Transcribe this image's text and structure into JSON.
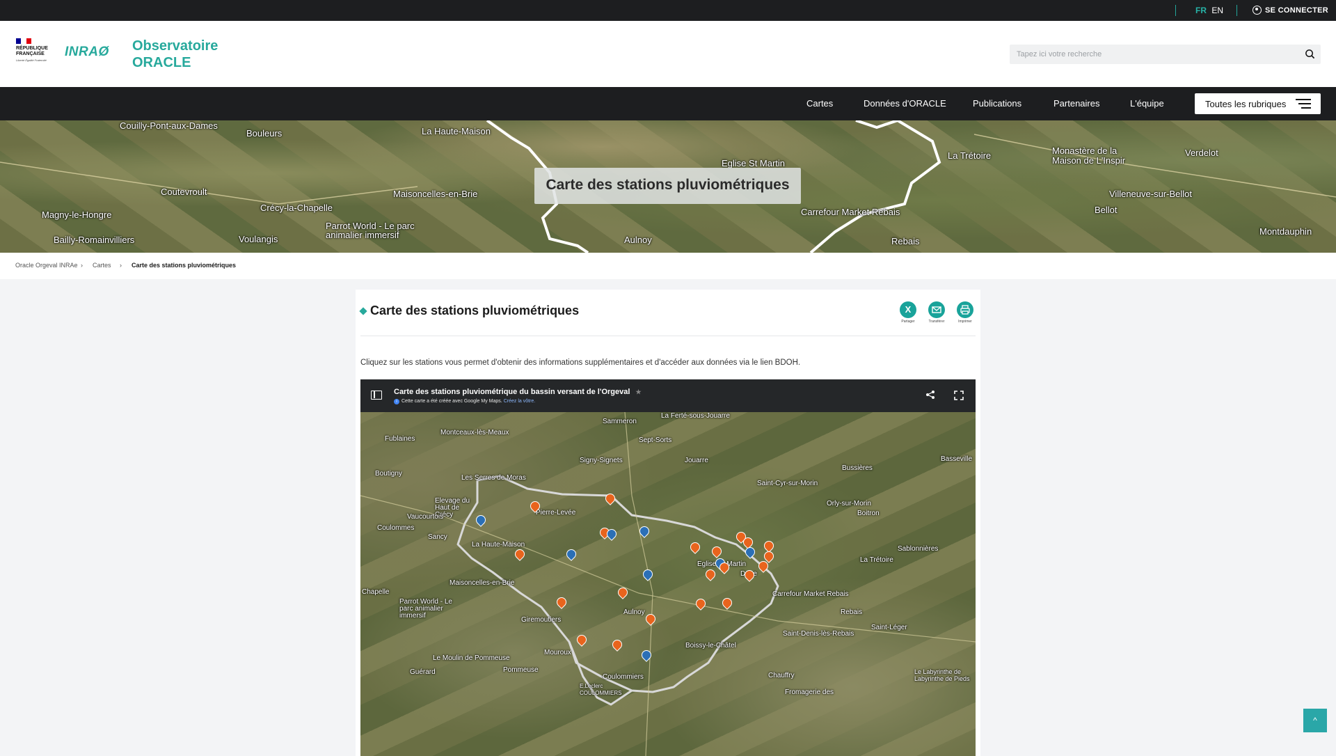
{
  "topbar": {
    "lang_fr": "FR",
    "lang_en": "EN",
    "login_label": "SE CONNECTER"
  },
  "header": {
    "republique_line1": "RÉPUBLIQUE",
    "republique_line2": "FRANÇAISE",
    "motto": "Liberté Égalité Fraternité",
    "inrae": "INRAØ",
    "obs_line1": "Observatoire",
    "obs_line2": "ORACLE",
    "search_placeholder": "Tapez ici votre recherche"
  },
  "nav": {
    "items": [
      "Cartes",
      "Données d'ORACLE",
      "Publications",
      "Partenaires",
      "L'équipe"
    ],
    "all_label": "Toutes les rubriques"
  },
  "hero": {
    "title": "Carte des stations pluviométriques",
    "places": [
      "Couilly-Pont-aux-Dames",
      "Bouleurs",
      "La Haute-Maison",
      "Eglise St Martin",
      "La Trétoire",
      "Verdelot",
      "Magny-le-Hongre",
      "Coutevroult",
      "Maisoncelles-en-Brie",
      "Crécy-la-Chapelle",
      "Carrefour Market Rebais",
      "Villeneuve-sur-Bellot",
      "Bellot",
      "Bailly-Romainvilliers",
      "Voulangis",
      "Aulnoy",
      "Rebais",
      "Montdauphin",
      "Monastère de la Maison de L'Inspir",
      "Parrot World - Le parc animalier immersif"
    ]
  },
  "breadcrumb": {
    "items": [
      "Oracle Orgeval INRAe",
      "Cartes",
      "Carte des stations pluviométriques"
    ]
  },
  "article": {
    "title": "Carte des stations pluviométriques",
    "share_labels": [
      "Partager",
      "Transférer",
      "Imprimer"
    ],
    "intro": "Cliquez sur les stations vous permet d'obtenir des informations supplémentaires et d'accéder aux données via le lien BDOH."
  },
  "embed": {
    "title": "Carte des stations pluviométrique du bassin versant de l'Orgeval",
    "subtitle": "Cette carte a été créée avec Google My Maps.",
    "subtitle_link": "Créez la vôtre.",
    "places": [
      "La Ferté-sous-Jouarre",
      "Sammeron",
      "Montceaux-lès-Meaux",
      "Fublaines",
      "Sept-Sorts",
      "Signy-Signets",
      "Jouarre",
      "Basseville",
      "Boutigny",
      "Les Serres de Moras",
      "Saint-Cyr-sur-Morin",
      "Bussières",
      "Elevage du Haut de Crécy",
      "Pierre-Levée",
      "Orly-sur-Morin",
      "Vaucourtois",
      "Boitron",
      "Coulommes",
      "Sancy",
      "La Haute-Maison",
      "Sablonnières",
      "La Trétoire",
      "Eglise St Martin",
      "Doue",
      "Maisoncelles-en-Brie",
      "Chapelle",
      "Carrefour Market Rebais",
      "Parrot World - Le parc animalier immersif",
      "Aulnoy",
      "Rebais",
      "Giremoutiers",
      "Saint-Léger",
      "Saint-Denis-lès-Rebais",
      "Boissy-le-Châtel",
      "Le Moulin de Pommeuse",
      "Mouroux",
      "Pommeuse",
      "Guérard",
      "Coulommiers",
      "Chauffry",
      "E.Leclerc COULOMMIERS",
      "Fromagerie des",
      "Le Labyrinthe de Labyrinthe de Pieds"
    ]
  },
  "colors": {
    "accent": "#27a99c",
    "dark": "#1d1e20",
    "station_rain": "#e8641d",
    "station_other": "#2b6fb6"
  },
  "back_to_top": "^"
}
